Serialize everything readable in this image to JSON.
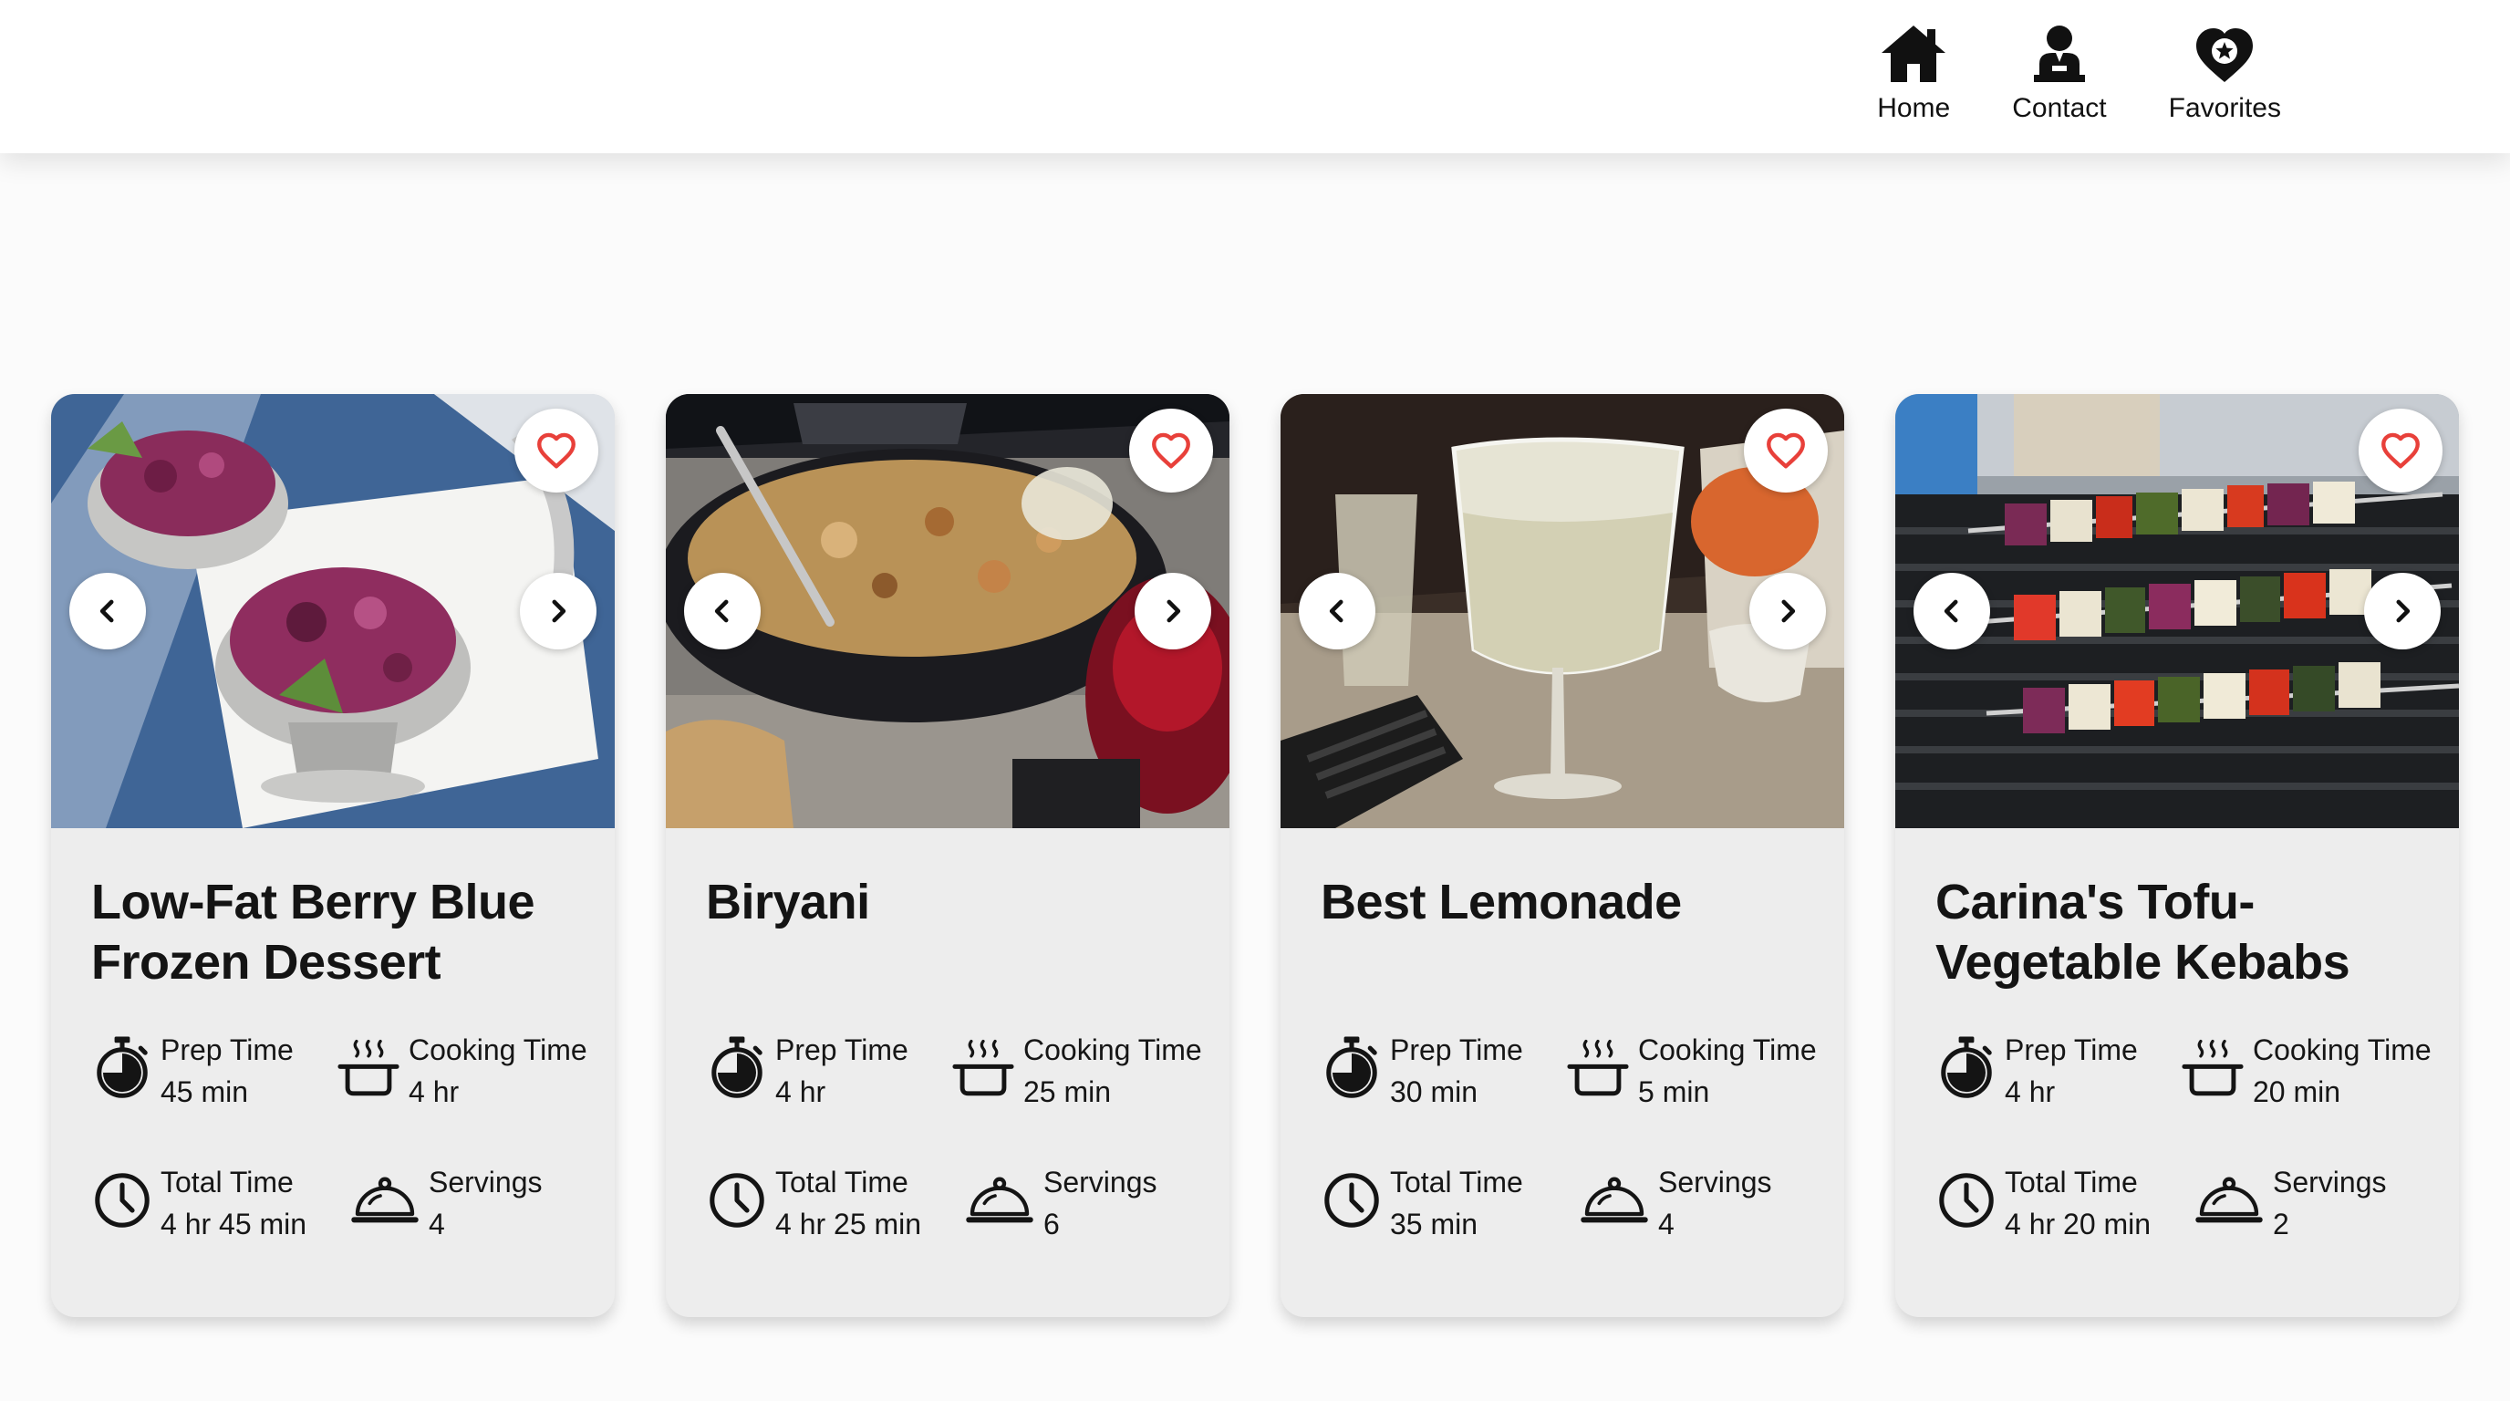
{
  "nav": {
    "items": [
      {
        "label": "Home",
        "icon": "home-icon"
      },
      {
        "label": "Contact",
        "icon": "contact-icon"
      },
      {
        "label": "Favorites",
        "icon": "favorites-icon"
      }
    ]
  },
  "colors": {
    "heart": "#e8403a",
    "card_bg": "#ededed",
    "header_bg": "#ffffff"
  },
  "stat_labels": {
    "prep": "Prep Time",
    "cook": "Cooking Time",
    "total": "Total Time",
    "servings": "Servings"
  },
  "cards": [
    {
      "title": "Low-Fat Berry Blue Frozen Dessert",
      "prep": "45 min",
      "cook": "4 hr",
      "total": "4 hr 45 min",
      "servings": "4"
    },
    {
      "title": "Biryani",
      "prep": "4 hr",
      "cook": "25 min",
      "total": "4 hr 25 min",
      "servings": "6"
    },
    {
      "title": "Best Lemonade",
      "prep": "30 min",
      "cook": "5 min",
      "total": "35 min",
      "servings": "4"
    },
    {
      "title": "Carina's Tofu-Vegetable Kebabs",
      "prep": "4 hr",
      "cook": "20 min",
      "total": "4 hr 20 min",
      "servings": "2"
    }
  ]
}
